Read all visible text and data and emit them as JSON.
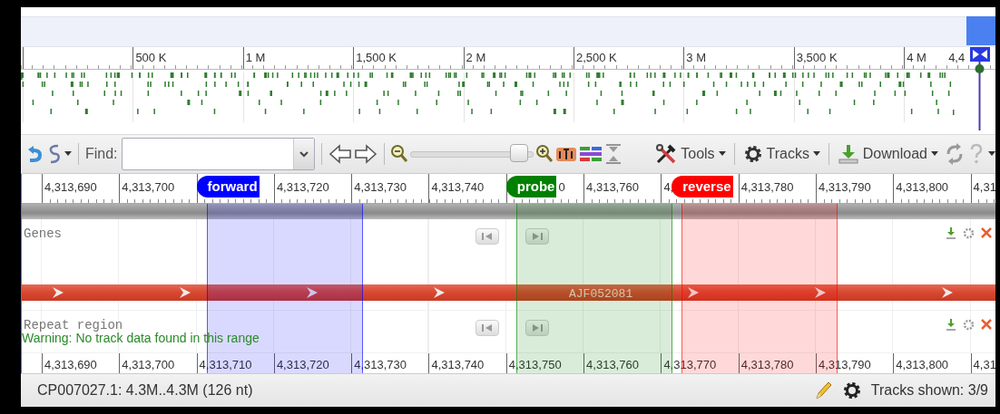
{
  "overview": {
    "scale_labels": [
      "500 K",
      "1 M",
      "1,500 K",
      "2 M",
      "2,500 K",
      "3 M",
      "3,500 K",
      "4 M",
      "4,4"
    ]
  },
  "toolbar": {
    "find_label": "Find:",
    "zoom": {
      "level": 0.88
    },
    "menus": [
      {
        "label": "Tools",
        "kind": "tools"
      },
      {
        "label": "Tracks",
        "kind": "tracks"
      },
      {
        "label": "Download",
        "kind": "download"
      }
    ]
  },
  "top_ruler": [
    {
      "parts": [
        {
          "kind": "text",
          "text": "4,313,690"
        }
      ]
    },
    {
      "parts": [
        {
          "kind": "text",
          "text": "4,313,700"
        }
      ]
    },
    {
      "parts": [
        {
          "kind": "flag",
          "name": "forward",
          "color": "#0000ff"
        }
      ]
    },
    {
      "parts": [
        {
          "kind": "text",
          "text": "4,313,720"
        }
      ]
    },
    {
      "parts": [
        {
          "kind": "text",
          "text": "4,313,730"
        }
      ]
    },
    {
      "parts": [
        {
          "kind": "text",
          "text": "4,313,740"
        }
      ]
    },
    {
      "parts": [
        {
          "kind": "flag",
          "name": "probe",
          "color": "#008000"
        },
        {
          "kind": "text",
          "text": "0"
        }
      ]
    },
    {
      "parts": [
        {
          "kind": "text",
          "text": "4,313,760"
        }
      ]
    },
    {
      "parts": [
        {
          "kind": "text",
          "text": "4,"
        },
        {
          "kind": "flag",
          "name": "reverse",
          "color": "#ff0000"
        }
      ]
    },
    {
      "parts": [
        {
          "kind": "text",
          "text": "4,313,780"
        }
      ]
    },
    {
      "parts": [
        {
          "kind": "text",
          "text": "4,313,790"
        }
      ]
    },
    {
      "parts": [
        {
          "kind": "text",
          "text": "4,313,800"
        }
      ]
    },
    {
      "parts": [
        {
          "kind": "text",
          "text": "4,31"
        }
      ]
    }
  ],
  "tracks": [
    {
      "label": "Genes",
      "kind": "features",
      "features": [
        {
          "name": "AJF052081"
        }
      ]
    },
    {
      "label": "Repeat region",
      "kind": "empty",
      "message": "Warning: No track data found in this range"
    }
  ],
  "bottom_ruler": [
    "4,313,690",
    "4,313,700",
    "4,313,710",
    "4,313,720",
    "4,313,730",
    "4,313,740",
    "4,313,750",
    "4,313,760",
    "4,313,770",
    "4,313,780",
    "4,313,790",
    "4,313,800",
    "4,31"
  ],
  "status": {
    "location": "CP007027.1: 4.3M..4.3M (126 nt)",
    "tracks_shown": "Tracks shown: 3/9"
  }
}
